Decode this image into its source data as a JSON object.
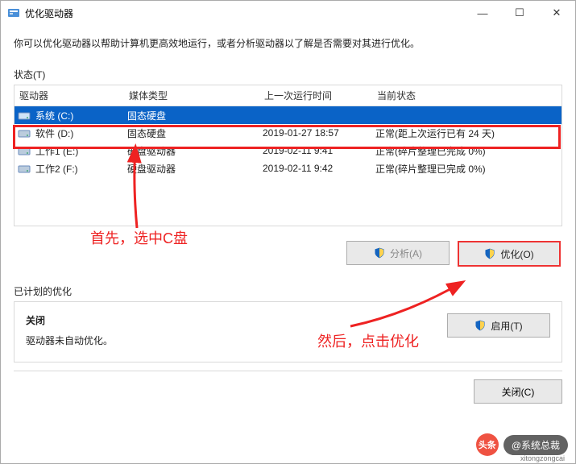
{
  "window": {
    "title": "优化驱动器"
  },
  "intro": "你可以优化驱动器以帮助计算机更高效地运行，或者分析驱动器以了解是否需要对其进行优化。",
  "status_label": "状态(T)",
  "columns": {
    "drive": "驱动器",
    "media": "媒体类型",
    "last": "上一次运行时间",
    "status": "当前状态"
  },
  "drives": [
    {
      "name": "系统 (C:)",
      "media": "固态硬盘",
      "last": "",
      "status": "",
      "selected": true,
      "blur": true
    },
    {
      "name": "软件 (D:)",
      "media": "固态硬盘",
      "last": "2019-01-27 18:57",
      "status": "正常(距上次运行已有 24 天)",
      "selected": false,
      "blur": false
    },
    {
      "name": "工作1 (E:)",
      "media": "硬盘驱动器",
      "last": "2019-02-11 9:41",
      "status": "正常(碎片整理已完成 0%)",
      "selected": false,
      "blur": false
    },
    {
      "name": "工作2 (F:)",
      "media": "硬盘驱动器",
      "last": "2019-02-11 9:42",
      "status": "正常(碎片整理已完成 0%)",
      "selected": false,
      "blur": false
    }
  ],
  "buttons": {
    "analyze": "分析(A)",
    "optimize": "优化(O)",
    "enable": "启用(T)",
    "close": "关闭(C)"
  },
  "schedule": {
    "label": "已计划的优化",
    "closed": "关闭",
    "desc": "驱动器未自动优化。"
  },
  "annotations": {
    "step1": "首先，选中C盘",
    "step2": "然后，点击优化"
  },
  "watermark": {
    "badge": "头条",
    "handle": "@系统总裁",
    "url": "xitongzongcai"
  }
}
